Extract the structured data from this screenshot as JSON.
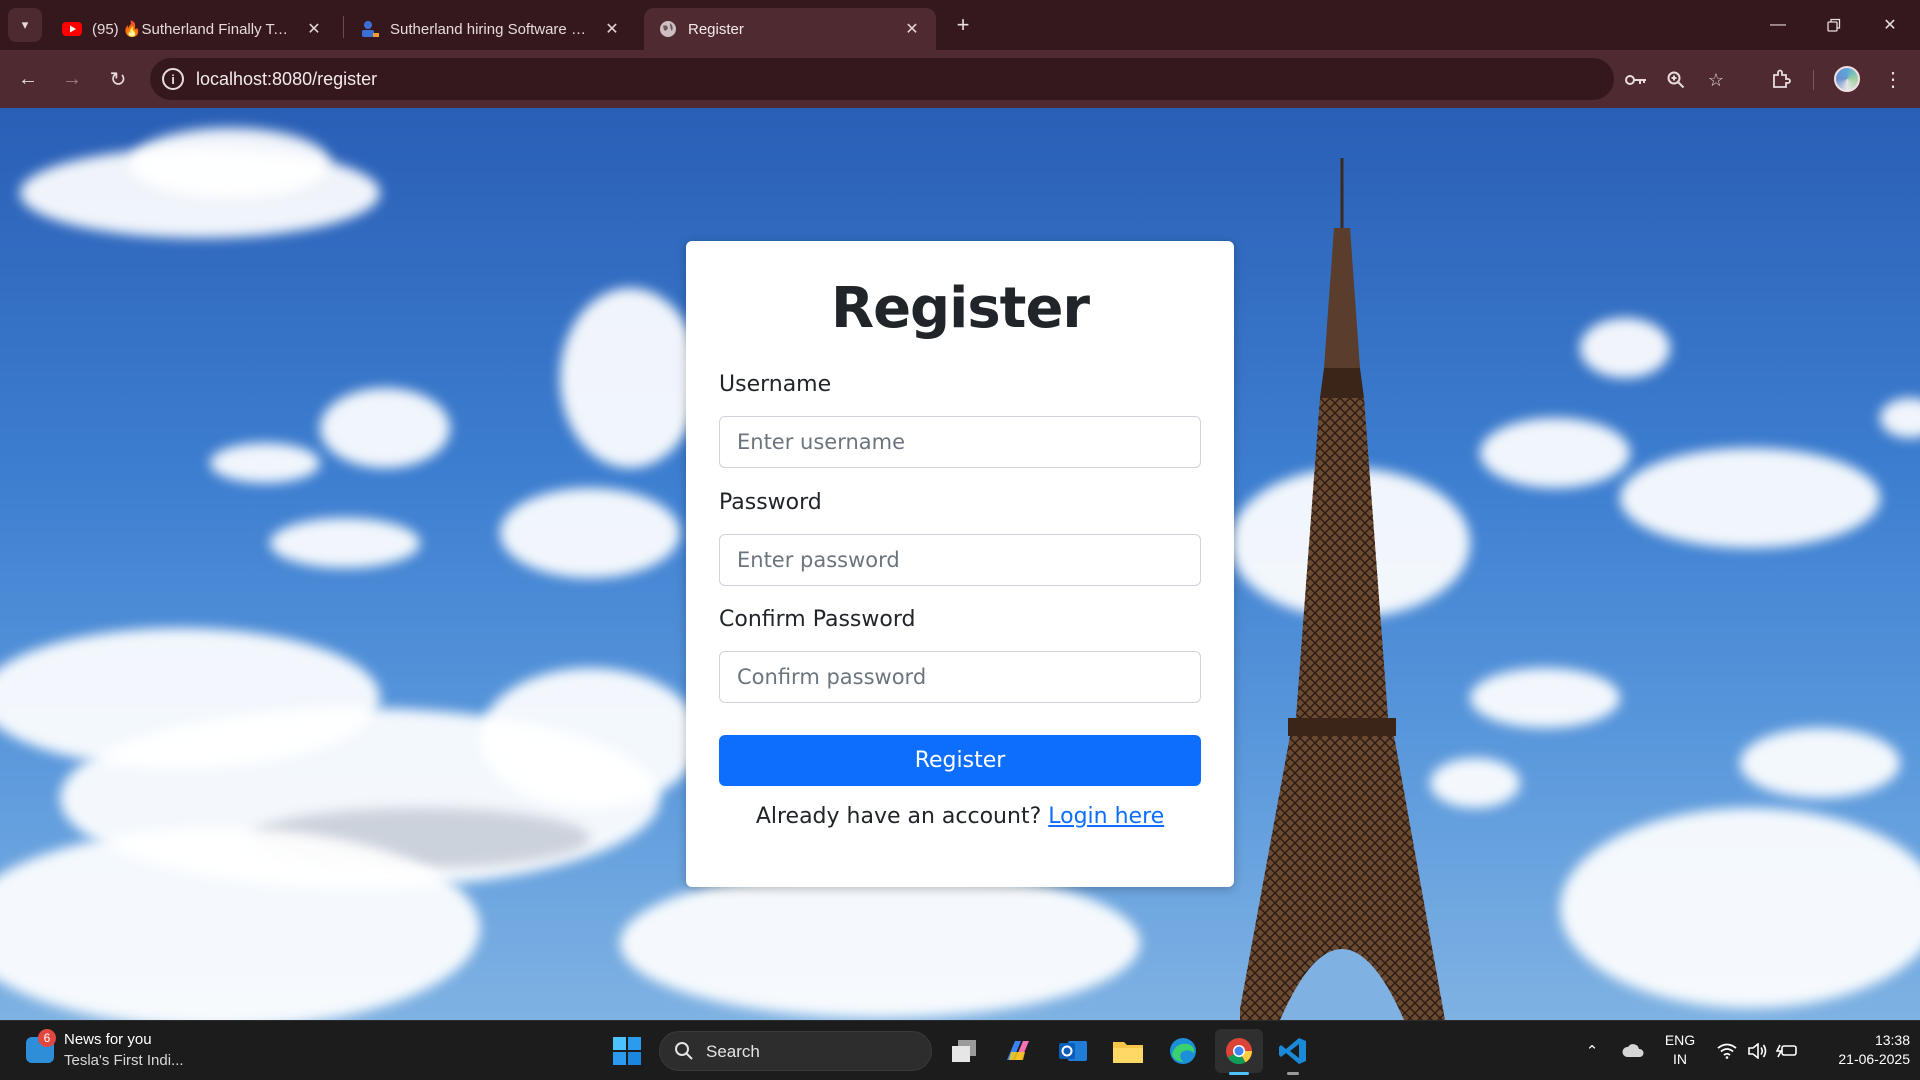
{
  "browser": {
    "tabs": [
      {
        "title": "(95) 🔥Sutherland Finally Tech Hiring",
        "favicon": "youtube-icon",
        "active": false
      },
      {
        "title": "Sutherland hiring Software Developer",
        "favicon": "job-site-icon",
        "active": false
      },
      {
        "title": "Register",
        "favicon": "globe-icon",
        "active": true
      }
    ],
    "address_bar": {
      "url": "localhost:8080/register"
    }
  },
  "page": {
    "heading": "Register",
    "username": {
      "label": "Username",
      "placeholder": "Enter username"
    },
    "password": {
      "label": "Password",
      "placeholder": "Enter password"
    },
    "confirm": {
      "label": "Confirm Password",
      "placeholder": "Confirm password"
    },
    "submit_label": "Register",
    "login_prompt": "Already have an account?",
    "login_link": "Login here",
    "colors": {
      "primary": "#0d6efd",
      "chrome": "#4f2a31",
      "tabstrip": "#35181d"
    }
  },
  "taskbar": {
    "news": {
      "badge": "6",
      "title": "News for you",
      "subtitle": "Tesla's First Indi..."
    },
    "search_label": "Search",
    "language": {
      "line1": "ENG",
      "line2": "IN"
    },
    "clock": {
      "time": "13:38",
      "date": "21-06-2025"
    }
  }
}
